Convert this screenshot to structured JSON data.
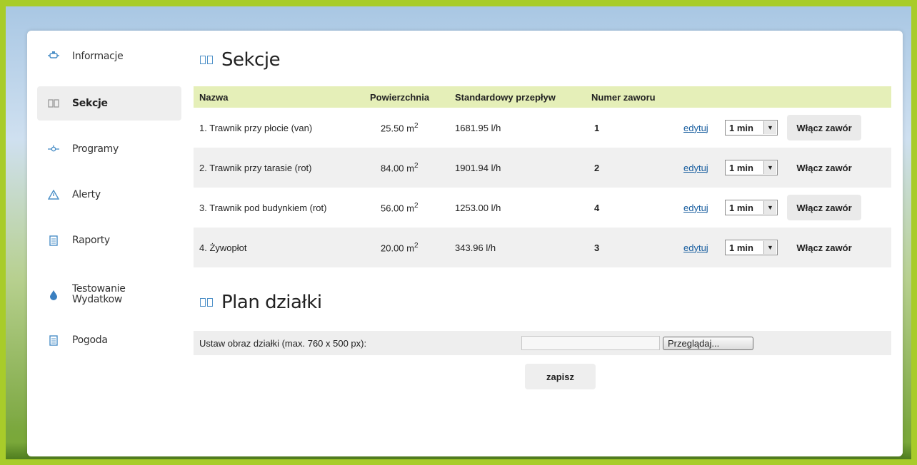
{
  "sidebar": {
    "items": [
      {
        "label": "Informacje",
        "icon": "info-valve-icon",
        "active": false
      },
      {
        "label": "Sekcje",
        "icon": "sections-icon",
        "active": true
      },
      {
        "label": "Programy",
        "icon": "programs-icon",
        "active": false
      },
      {
        "label": "Alerty",
        "icon": "alert-icon",
        "active": false
      },
      {
        "label": "Raporty",
        "icon": "report-icon",
        "active": false
      },
      {
        "label": "Testowanie Wydatkow",
        "icon": "water-drop-icon",
        "active": false
      },
      {
        "label": "Pogoda",
        "icon": "weather-doc-icon",
        "active": false
      }
    ]
  },
  "sections": {
    "title": "Sekcje",
    "headers": {
      "name": "Nazwa",
      "area": "Powierzchnia",
      "flow": "Standardowy przepływ",
      "valve": "Numer zaworu"
    },
    "rows": [
      {
        "name": "1. Trawnik przy płocie (van)",
        "area": "25.50 m",
        "area_sup": "2",
        "flow": "1681.95 l/h",
        "valve": "1",
        "edit": "edytuj",
        "duration": "1 min",
        "button": "Włącz zawór"
      },
      {
        "name": "2. Trawnik przy tarasie (rot)",
        "area": "84.00 m",
        "area_sup": "2",
        "flow": "1901.94 l/h",
        "valve": "2",
        "edit": "edytuj",
        "duration": "1 min",
        "button": "Włącz zawór"
      },
      {
        "name": "3. Trawnik pod budynkiem (rot)",
        "area": "56.00 m",
        "area_sup": "2",
        "flow": "1253.00 l/h",
        "valve": "4",
        "edit": "edytuj",
        "duration": "1 min",
        "button": "Włącz zawór"
      },
      {
        "name": "4. Żywopłot",
        "area": "20.00 m",
        "area_sup": "2",
        "flow": "343.96 l/h",
        "valve": "3",
        "edit": "edytuj",
        "duration": "1 min",
        "button": "Włącz zawór"
      }
    ]
  },
  "plan": {
    "title": "Plan działki",
    "label": "Ustaw obraz działki (max. 760 x 500 px):",
    "file_value": "",
    "browse": "Przeglądaj...",
    "save": "zapisz"
  },
  "colors": {
    "frame": "#a8cc2a",
    "header_row": "#e5efb8",
    "accent": "#4b8fc7",
    "link": "#1a5fa0"
  }
}
